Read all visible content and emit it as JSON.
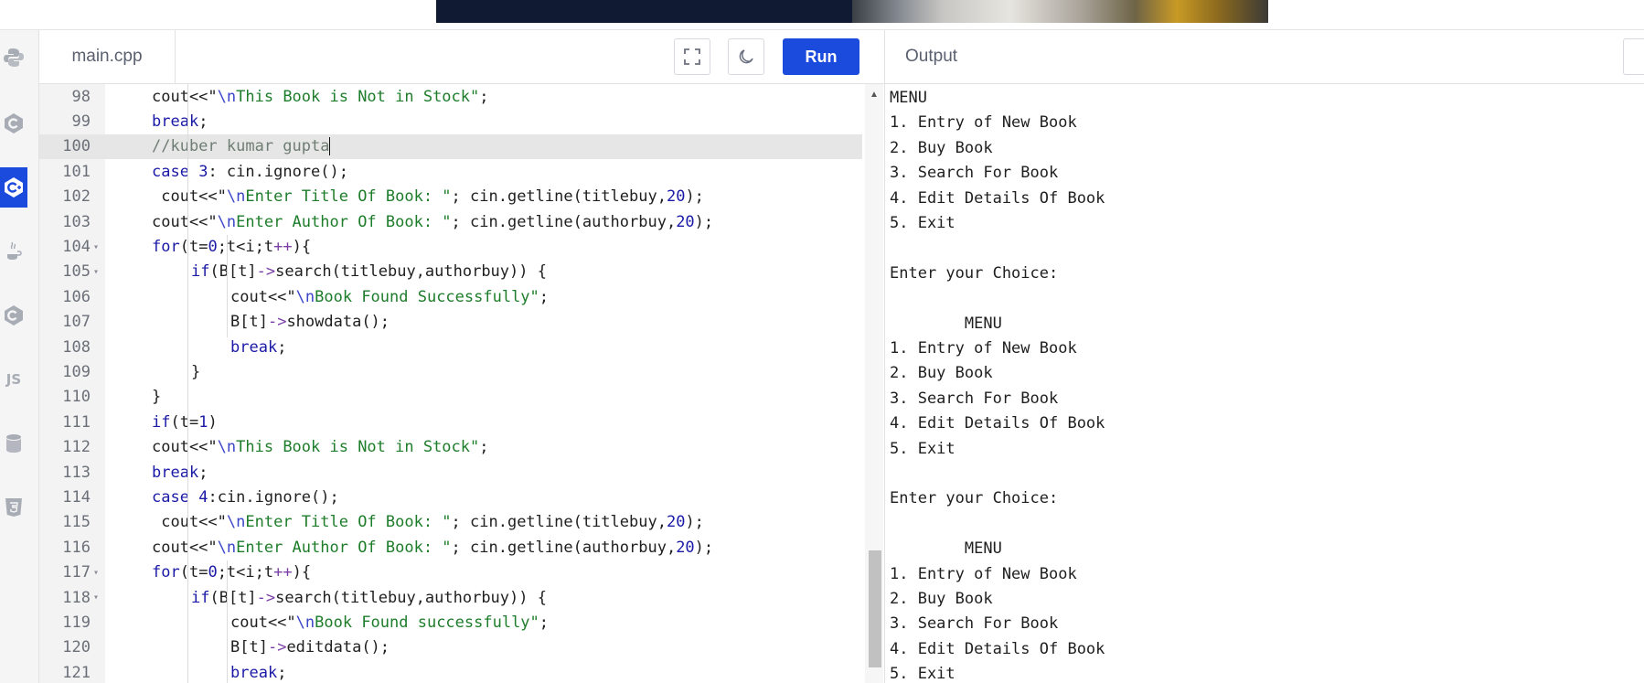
{
  "editor": {
    "file_tab": "main.cpp",
    "run_label": "Run",
    "lines": [
      {
        "n": "98",
        "fold": "",
        "indent": 0,
        "code": [
          [
            "",
            "cout<<\""
          ],
          [
            "esc",
            "\\n"
          ],
          [
            "str",
            "This Book is Not in Stock\""
          ],
          [
            "",
            ";"
          ]
        ]
      },
      {
        "n": "99",
        "fold": "",
        "indent": 0,
        "code": [
          [
            "kw",
            "break"
          ],
          [
            "",
            ";"
          ]
        ]
      },
      {
        "n": "100",
        "fold": "",
        "indent": 0,
        "active": true,
        "code": [
          [
            "cm",
            "//kuber kumar gupta"
          ]
        ]
      },
      {
        "n": "101",
        "fold": "",
        "indent": 0,
        "code": [
          [
            "kw",
            "case"
          ],
          [
            "",
            " "
          ],
          [
            "num",
            "3"
          ],
          [
            "",
            ": cin.ignore();"
          ]
        ]
      },
      {
        "n": "102",
        "fold": "",
        "indent": 0,
        "code": [
          [
            "",
            " cout<<\""
          ],
          [
            "esc",
            "\\n"
          ],
          [
            "str",
            "Enter Title Of Book: \""
          ],
          [
            "",
            "; cin.getline(titlebuy,"
          ],
          [
            "num",
            "20"
          ],
          [
            "",
            ");"
          ]
        ]
      },
      {
        "n": "103",
        "fold": "",
        "indent": 0,
        "code": [
          [
            "",
            "cout<<\""
          ],
          [
            "esc",
            "\\n"
          ],
          [
            "str",
            "Enter Author Of Book: \""
          ],
          [
            "",
            "; cin.getline(authorbuy,"
          ],
          [
            "num",
            "20"
          ],
          [
            "",
            ");"
          ]
        ]
      },
      {
        "n": "104",
        "fold": "▾",
        "indent": 0,
        "code": [
          [
            "kw",
            "for"
          ],
          [
            "",
            "(t="
          ],
          [
            "num",
            "0"
          ],
          [
            "",
            ";t<i;t"
          ],
          [
            "op",
            "++"
          ],
          [
            "",
            "){"
          ]
        ]
      },
      {
        "n": "105",
        "fold": "▾",
        "indent": 1,
        "code": [
          [
            "kw",
            "if"
          ],
          [
            "",
            "(B[t]"
          ],
          [
            "op",
            "->"
          ],
          [
            "",
            "search(titlebuy,authorbuy)) {"
          ]
        ]
      },
      {
        "n": "106",
        "fold": "",
        "indent": 2,
        "code": [
          [
            "",
            "cout<<\""
          ],
          [
            "esc",
            "\\n"
          ],
          [
            "str",
            "Book Found Successfully\""
          ],
          [
            "",
            ";"
          ]
        ]
      },
      {
        "n": "107",
        "fold": "",
        "indent": 2,
        "code": [
          [
            "",
            "B[t]"
          ],
          [
            "op",
            "->"
          ],
          [
            "",
            "showdata();"
          ]
        ]
      },
      {
        "n": "108",
        "fold": "",
        "indent": 2,
        "code": [
          [
            "kw",
            "break"
          ],
          [
            "",
            ";"
          ]
        ]
      },
      {
        "n": "109",
        "fold": "",
        "indent": 1,
        "code": [
          [
            "",
            "}"
          ]
        ]
      },
      {
        "n": "110",
        "fold": "",
        "indent": 0,
        "code": [
          [
            "",
            "}"
          ]
        ]
      },
      {
        "n": "111",
        "fold": "",
        "indent": 0,
        "code": [
          [
            "kw",
            "if"
          ],
          [
            "",
            "(t="
          ],
          [
            "num",
            "1"
          ],
          [
            "",
            ")"
          ]
        ]
      },
      {
        "n": "112",
        "fold": "",
        "indent": 0,
        "code": [
          [
            "",
            "cout<<\""
          ],
          [
            "esc",
            "\\n"
          ],
          [
            "str",
            "This Book is Not in Stock\""
          ],
          [
            "",
            ";"
          ]
        ]
      },
      {
        "n": "113",
        "fold": "",
        "indent": 0,
        "code": [
          [
            "kw",
            "break"
          ],
          [
            "",
            ";"
          ]
        ]
      },
      {
        "n": "114",
        "fold": "",
        "indent": 0,
        "code": [
          [
            "kw",
            "case"
          ],
          [
            "",
            " "
          ],
          [
            "num",
            "4"
          ],
          [
            "",
            ":cin.ignore();"
          ]
        ]
      },
      {
        "n": "115",
        "fold": "",
        "indent": 0,
        "code": [
          [
            "",
            " cout<<\""
          ],
          [
            "esc",
            "\\n"
          ],
          [
            "str",
            "Enter Title Of Book: \""
          ],
          [
            "",
            "; cin.getline(titlebuy,"
          ],
          [
            "num",
            "20"
          ],
          [
            "",
            ");"
          ]
        ]
      },
      {
        "n": "116",
        "fold": "",
        "indent": 0,
        "code": [
          [
            "",
            "cout<<\""
          ],
          [
            "esc",
            "\\n"
          ],
          [
            "str",
            "Enter Author Of Book: \""
          ],
          [
            "",
            "; cin.getline(authorbuy,"
          ],
          [
            "num",
            "20"
          ],
          [
            "",
            ");"
          ]
        ]
      },
      {
        "n": "117",
        "fold": "▾",
        "indent": 0,
        "code": [
          [
            "kw",
            "for"
          ],
          [
            "",
            "(t="
          ],
          [
            "num",
            "0"
          ],
          [
            "",
            ";t<i;t"
          ],
          [
            "op",
            "++"
          ],
          [
            "",
            "){"
          ]
        ]
      },
      {
        "n": "118",
        "fold": "▾",
        "indent": 1,
        "code": [
          [
            "kw",
            "if"
          ],
          [
            "",
            "(B[t]"
          ],
          [
            "op",
            "->"
          ],
          [
            "",
            "search(titlebuy,authorbuy)) {"
          ]
        ]
      },
      {
        "n": "119",
        "fold": "",
        "indent": 2,
        "code": [
          [
            "",
            "cout<<\""
          ],
          [
            "esc",
            "\\n"
          ],
          [
            "str",
            "Book Found successfully\""
          ],
          [
            "",
            ";"
          ]
        ]
      },
      {
        "n": "120",
        "fold": "",
        "indent": 2,
        "code": [
          [
            "",
            "B[t]"
          ],
          [
            "op",
            "->"
          ],
          [
            "",
            "editdata();"
          ]
        ]
      },
      {
        "n": "121",
        "fold": "",
        "indent": 2,
        "code": [
          [
            "kw",
            "break"
          ],
          [
            "",
            ";"
          ]
        ]
      }
    ]
  },
  "output": {
    "title": "Output",
    "lines": [
      "MENU",
      "1. Entry of New Book",
      "2. Buy Book",
      "3. Search For Book",
      "4. Edit Details Of Book",
      "5. Exit",
      "",
      "Enter your Choice:",
      "",
      "        MENU",
      "1. Entry of New Book",
      "2. Buy Book",
      "3. Search For Book",
      "4. Edit Details Of Book",
      "5. Exit",
      "",
      "Enter your Choice:",
      "",
      "        MENU",
      "1. Entry of New Book",
      "2. Buy Book",
      "3. Search For Book",
      "4. Edit Details Of Book",
      "5. Exit"
    ]
  },
  "sidebar": {
    "languages": [
      {
        "icon": "python-icon",
        "active": false
      },
      {
        "icon": "c-icon",
        "active": false
      },
      {
        "icon": "cpp-icon",
        "active": true
      },
      {
        "icon": "java-icon",
        "active": false
      },
      {
        "icon": "csharp-icon",
        "active": false
      },
      {
        "icon": "javascript-icon",
        "active": false,
        "text": "JS"
      },
      {
        "icon": "database-icon",
        "active": false
      },
      {
        "icon": "html5-icon",
        "active": false
      }
    ]
  }
}
